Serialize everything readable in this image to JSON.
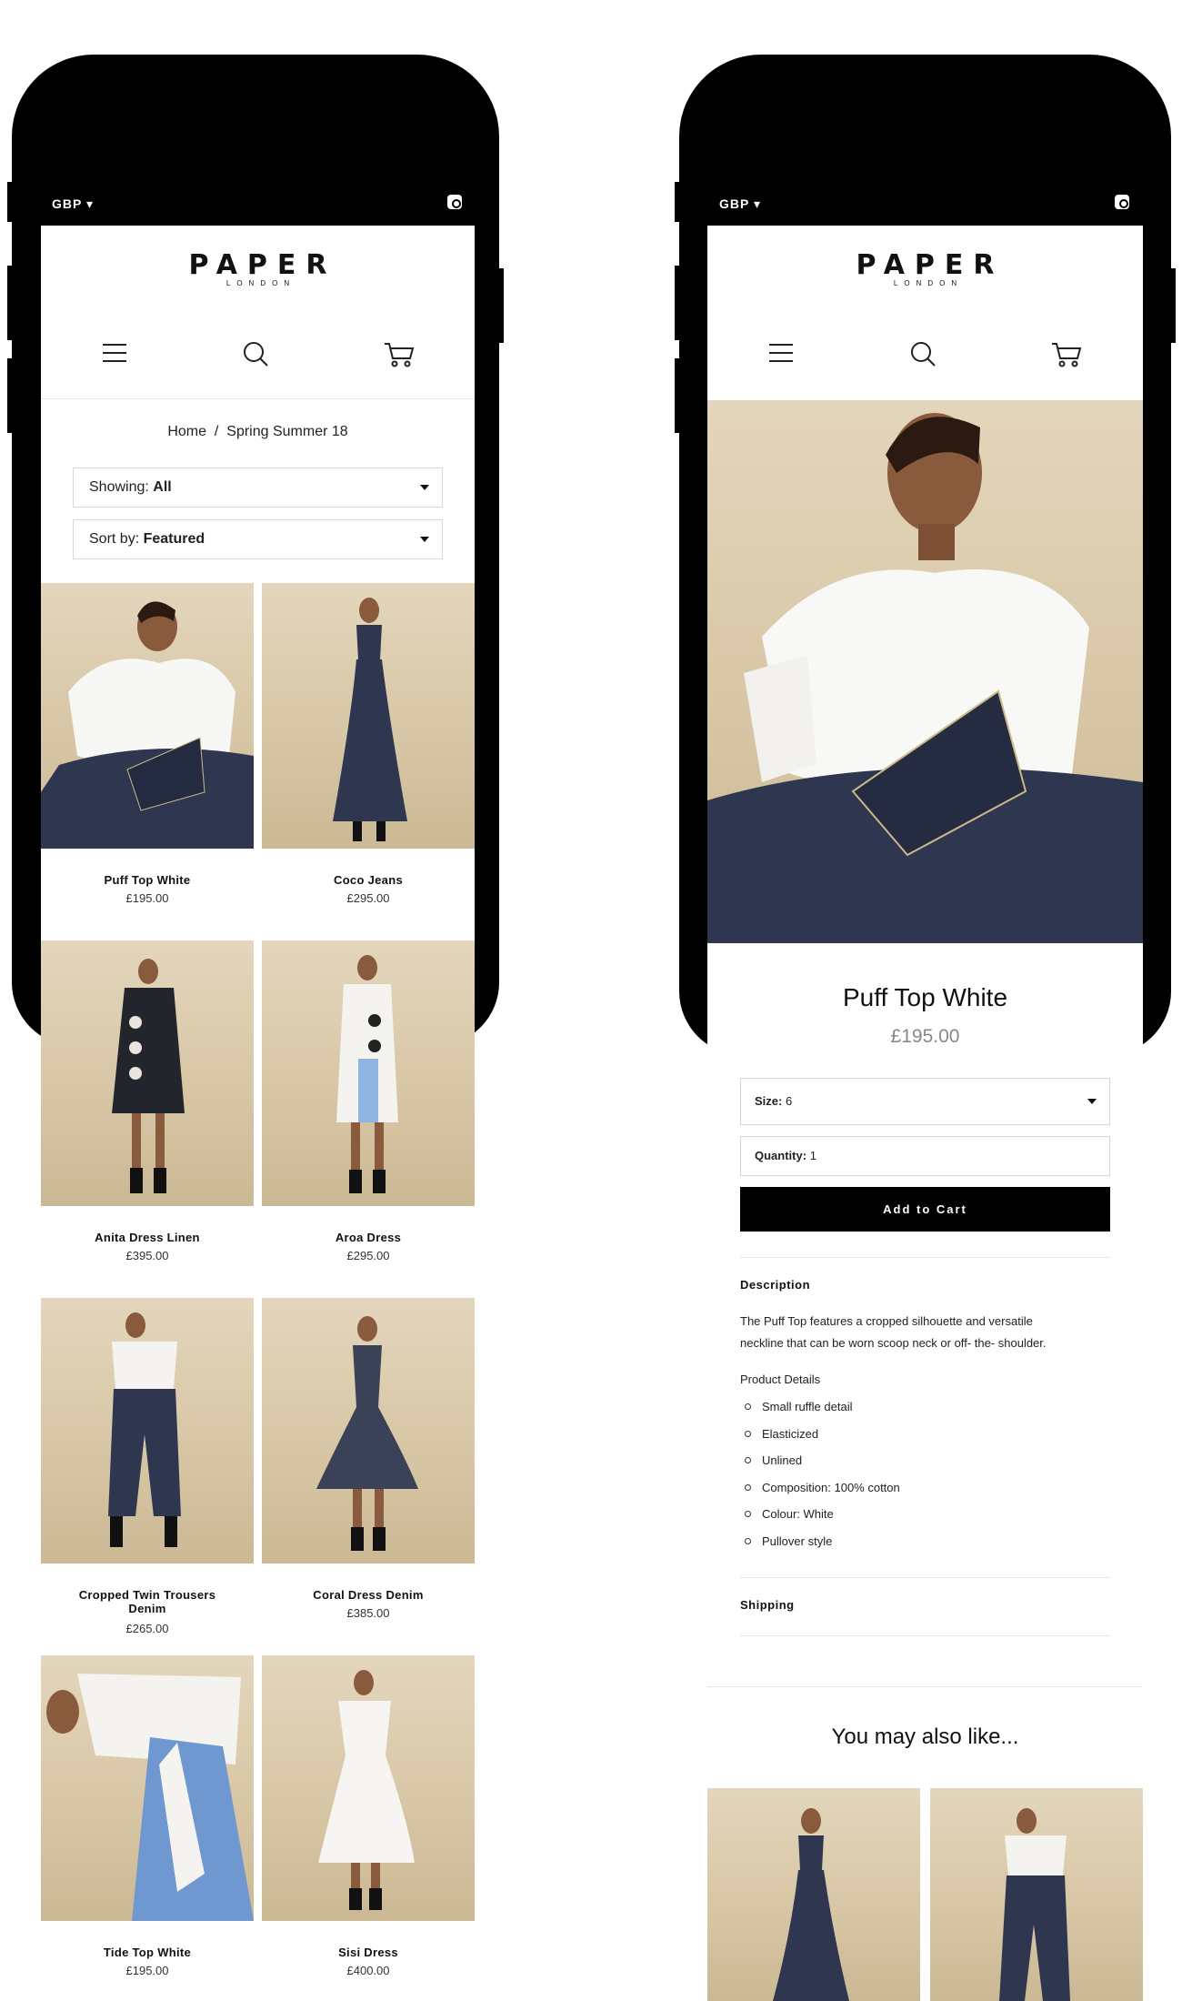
{
  "left_phone": {
    "status": {
      "currency": "GBP ▾"
    },
    "logo": {
      "main": "PAPER",
      "sub": "LONDON"
    },
    "nav": {
      "menu": "menu-icon",
      "search": "search-icon",
      "cart": "cart-icon"
    },
    "breadcrumb": {
      "home": "Home",
      "separator": "/",
      "current": "Spring Summer 18"
    },
    "filter": {
      "label": "Showing:",
      "value": "All"
    },
    "sort": {
      "label": "Sort by:",
      "value": "Featured"
    },
    "products": [
      {
        "name": "Puff Top White",
        "price": "£195.00"
      },
      {
        "name": "Coco Jeans",
        "price": "£295.00"
      },
      {
        "name": "Anita Dress Linen",
        "price": "£395.00"
      },
      {
        "name": "Aroa Dress",
        "price": "£295.00"
      },
      {
        "name": "Cropped Twin Trousers",
        "name2": "Denim",
        "price": "£265.00"
      },
      {
        "name": "Coral Dress Denim",
        "price": "£385.00"
      },
      {
        "name": "Tide Top White",
        "price": "£195.00"
      },
      {
        "name": "Sisi Dress",
        "price": "£400.00"
      }
    ]
  },
  "right_phone": {
    "status": {
      "currency": "GBP ▾"
    },
    "logo": {
      "main": "PAPER",
      "sub": "LONDON"
    },
    "product": {
      "title": "Puff Top White",
      "price": "£195.00",
      "size_label": "Size:",
      "size_value": "6",
      "quantity_label": "Quantity:",
      "quantity_value": "1",
      "add_to_cart": "Add to Cart",
      "description_title": "Description",
      "description_line1": "The Puff Top features a cropped silhouette and versatile",
      "description_line2": "neckline that can be worn scoop neck or off- the- shoulder.",
      "details_title": "Product Details",
      "details": [
        "Small ruffle detail",
        "Elasticized",
        "Unlined",
        "Composition: 100% cotton",
        "Colour: White",
        "Pullover style"
      ],
      "shipping_title": "Shipping"
    },
    "also_like": {
      "title": "You may also like..."
    }
  },
  "colors": {
    "accent": "#000000",
    "background": "#ffffff",
    "photo_bg": "#d8c7a6",
    "denim": "#2f3650"
  }
}
